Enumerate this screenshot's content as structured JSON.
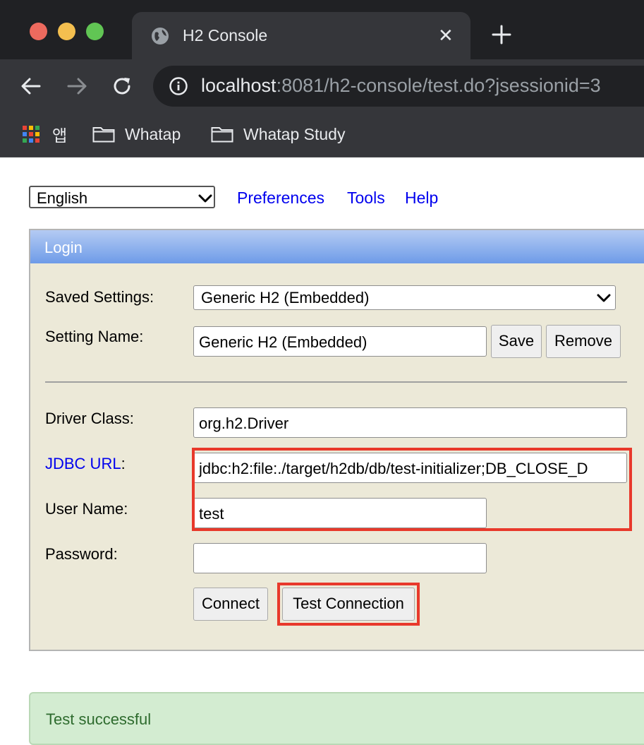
{
  "browser": {
    "tab_title": "H2 Console",
    "tab_close": "✕",
    "url_host": "localhost",
    "url_rest": ":8081/h2-console/test.do?jsessionid=3",
    "bookmarks": [
      {
        "label": "앱",
        "icon": "apps-grid-icon"
      },
      {
        "label": "Whatap",
        "icon": "folder-icon"
      },
      {
        "label": "Whatap Study",
        "icon": "folder-icon"
      }
    ]
  },
  "topbar": {
    "language": "English",
    "links": [
      "Preferences",
      "Tools",
      "Help"
    ]
  },
  "login": {
    "title": "Login",
    "saved_settings_label": "Saved Settings:",
    "saved_settings_value": "Generic H2 (Embedded)",
    "setting_name_label": "Setting Name:",
    "setting_name_value": "Generic H2 (Embedded)",
    "save_label": "Save",
    "remove_label": "Remove",
    "driver_class_label": "Driver Class:",
    "driver_class_value": "org.h2.Driver",
    "jdbc_url_link": "JDBC URL",
    "jdbc_url_colon": ":",
    "jdbc_url_value": "jdbc:h2:file:./target/h2db/db/test-initializer;DB_CLOSE_D",
    "user_name_label": "User Name:",
    "user_name_value": "test",
    "password_label": "Password:",
    "password_value": "",
    "connect_label": "Connect",
    "test_connection_label": "Test Connection"
  },
  "status": {
    "message": "Test successful"
  },
  "colors": {
    "highlight": "#e8392b",
    "link": "#0000ee",
    "panel_bg": "#ece9d8",
    "header_gradient_top": "#b4cbf3",
    "header_gradient_bottom": "#6e9be8",
    "success_bg": "#d3ecd1"
  }
}
